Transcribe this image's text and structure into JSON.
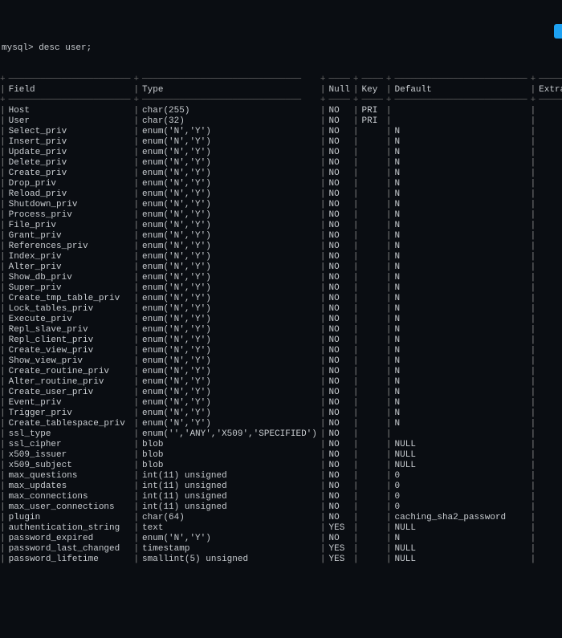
{
  "prompt": "mysql> desc user;",
  "headers": {
    "field": "Field",
    "type": "Type",
    "null": "Null",
    "key": "Key",
    "default": "Default",
    "extra": "Extra"
  },
  "rows": [
    {
      "field": "Host",
      "type": "char(255)",
      "null": "NO",
      "key": "PRI",
      "default": "",
      "extra": ""
    },
    {
      "field": "User",
      "type": "char(32)",
      "null": "NO",
      "key": "PRI",
      "default": "",
      "extra": ""
    },
    {
      "field": "Select_priv",
      "type": "enum('N','Y')",
      "null": "NO",
      "key": "",
      "default": "N",
      "extra": ""
    },
    {
      "field": "Insert_priv",
      "type": "enum('N','Y')",
      "null": "NO",
      "key": "",
      "default": "N",
      "extra": ""
    },
    {
      "field": "Update_priv",
      "type": "enum('N','Y')",
      "null": "NO",
      "key": "",
      "default": "N",
      "extra": ""
    },
    {
      "field": "Delete_priv",
      "type": "enum('N','Y')",
      "null": "NO",
      "key": "",
      "default": "N",
      "extra": ""
    },
    {
      "field": "Create_priv",
      "type": "enum('N','Y')",
      "null": "NO",
      "key": "",
      "default": "N",
      "extra": ""
    },
    {
      "field": "Drop_priv",
      "type": "enum('N','Y')",
      "null": "NO",
      "key": "",
      "default": "N",
      "extra": ""
    },
    {
      "field": "Reload_priv",
      "type": "enum('N','Y')",
      "null": "NO",
      "key": "",
      "default": "N",
      "extra": ""
    },
    {
      "field": "Shutdown_priv",
      "type": "enum('N','Y')",
      "null": "NO",
      "key": "",
      "default": "N",
      "extra": ""
    },
    {
      "field": "Process_priv",
      "type": "enum('N','Y')",
      "null": "NO",
      "key": "",
      "default": "N",
      "extra": ""
    },
    {
      "field": "File_priv",
      "type": "enum('N','Y')",
      "null": "NO",
      "key": "",
      "default": "N",
      "extra": ""
    },
    {
      "field": "Grant_priv",
      "type": "enum('N','Y')",
      "null": "NO",
      "key": "",
      "default": "N",
      "extra": ""
    },
    {
      "field": "References_priv",
      "type": "enum('N','Y')",
      "null": "NO",
      "key": "",
      "default": "N",
      "extra": ""
    },
    {
      "field": "Index_priv",
      "type": "enum('N','Y')",
      "null": "NO",
      "key": "",
      "default": "N",
      "extra": ""
    },
    {
      "field": "Alter_priv",
      "type": "enum('N','Y')",
      "null": "NO",
      "key": "",
      "default": "N",
      "extra": ""
    },
    {
      "field": "Show_db_priv",
      "type": "enum('N','Y')",
      "null": "NO",
      "key": "",
      "default": "N",
      "extra": ""
    },
    {
      "field": "Super_priv",
      "type": "enum('N','Y')",
      "null": "NO",
      "key": "",
      "default": "N",
      "extra": ""
    },
    {
      "field": "Create_tmp_table_priv",
      "type": "enum('N','Y')",
      "null": "NO",
      "key": "",
      "default": "N",
      "extra": ""
    },
    {
      "field": "Lock_tables_priv",
      "type": "enum('N','Y')",
      "null": "NO",
      "key": "",
      "default": "N",
      "extra": ""
    },
    {
      "field": "Execute_priv",
      "type": "enum('N','Y')",
      "null": "NO",
      "key": "",
      "default": "N",
      "extra": ""
    },
    {
      "field": "Repl_slave_priv",
      "type": "enum('N','Y')",
      "null": "NO",
      "key": "",
      "default": "N",
      "extra": ""
    },
    {
      "field": "Repl_client_priv",
      "type": "enum('N','Y')",
      "null": "NO",
      "key": "",
      "default": "N",
      "extra": ""
    },
    {
      "field": "Create_view_priv",
      "type": "enum('N','Y')",
      "null": "NO",
      "key": "",
      "default": "N",
      "extra": ""
    },
    {
      "field": "Show_view_priv",
      "type": "enum('N','Y')",
      "null": "NO",
      "key": "",
      "default": "N",
      "extra": ""
    },
    {
      "field": "Create_routine_priv",
      "type": "enum('N','Y')",
      "null": "NO",
      "key": "",
      "default": "N",
      "extra": ""
    },
    {
      "field": "Alter_routine_priv",
      "type": "enum('N','Y')",
      "null": "NO",
      "key": "",
      "default": "N",
      "extra": ""
    },
    {
      "field": "Create_user_priv",
      "type": "enum('N','Y')",
      "null": "NO",
      "key": "",
      "default": "N",
      "extra": ""
    },
    {
      "field": "Event_priv",
      "type": "enum('N','Y')",
      "null": "NO",
      "key": "",
      "default": "N",
      "extra": ""
    },
    {
      "field": "Trigger_priv",
      "type": "enum('N','Y')",
      "null": "NO",
      "key": "",
      "default": "N",
      "extra": ""
    },
    {
      "field": "Create_tablespace_priv",
      "type": "enum('N','Y')",
      "null": "NO",
      "key": "",
      "default": "N",
      "extra": ""
    },
    {
      "field": "ssl_type",
      "type": "enum('','ANY','X509','SPECIFIED')",
      "null": "NO",
      "key": "",
      "default": "",
      "extra": ""
    },
    {
      "field": "ssl_cipher",
      "type": "blob",
      "null": "NO",
      "key": "",
      "default": "NULL",
      "extra": ""
    },
    {
      "field": "x509_issuer",
      "type": "blob",
      "null": "NO",
      "key": "",
      "default": "NULL",
      "extra": ""
    },
    {
      "field": "x509_subject",
      "type": "blob",
      "null": "NO",
      "key": "",
      "default": "NULL",
      "extra": ""
    },
    {
      "field": "max_questions",
      "type": "int(11) unsigned",
      "null": "NO",
      "key": "",
      "default": "0",
      "extra": ""
    },
    {
      "field": "max_updates",
      "type": "int(11) unsigned",
      "null": "NO",
      "key": "",
      "default": "0",
      "extra": ""
    },
    {
      "field": "max_connections",
      "type": "int(11) unsigned",
      "null": "NO",
      "key": "",
      "default": "0",
      "extra": ""
    },
    {
      "field": "max_user_connections",
      "type": "int(11) unsigned",
      "null": "NO",
      "key": "",
      "default": "0",
      "extra": ""
    },
    {
      "field": "plugin",
      "type": "char(64)",
      "null": "NO",
      "key": "",
      "default": "caching_sha2_password",
      "extra": ""
    },
    {
      "field": "authentication_string",
      "type": "text",
      "null": "YES",
      "key": "",
      "default": "NULL",
      "extra": ""
    },
    {
      "field": "password_expired",
      "type": "enum('N','Y')",
      "null": "NO",
      "key": "",
      "default": "N",
      "extra": ""
    },
    {
      "field": "password_last_changed",
      "type": "timestamp",
      "null": "YES",
      "key": "",
      "default": "NULL",
      "extra": ""
    },
    {
      "field": "password_lifetime",
      "type": "smallint(5) unsigned",
      "null": "YES",
      "key": "",
      "default": "NULL",
      "extra": ""
    }
  ]
}
